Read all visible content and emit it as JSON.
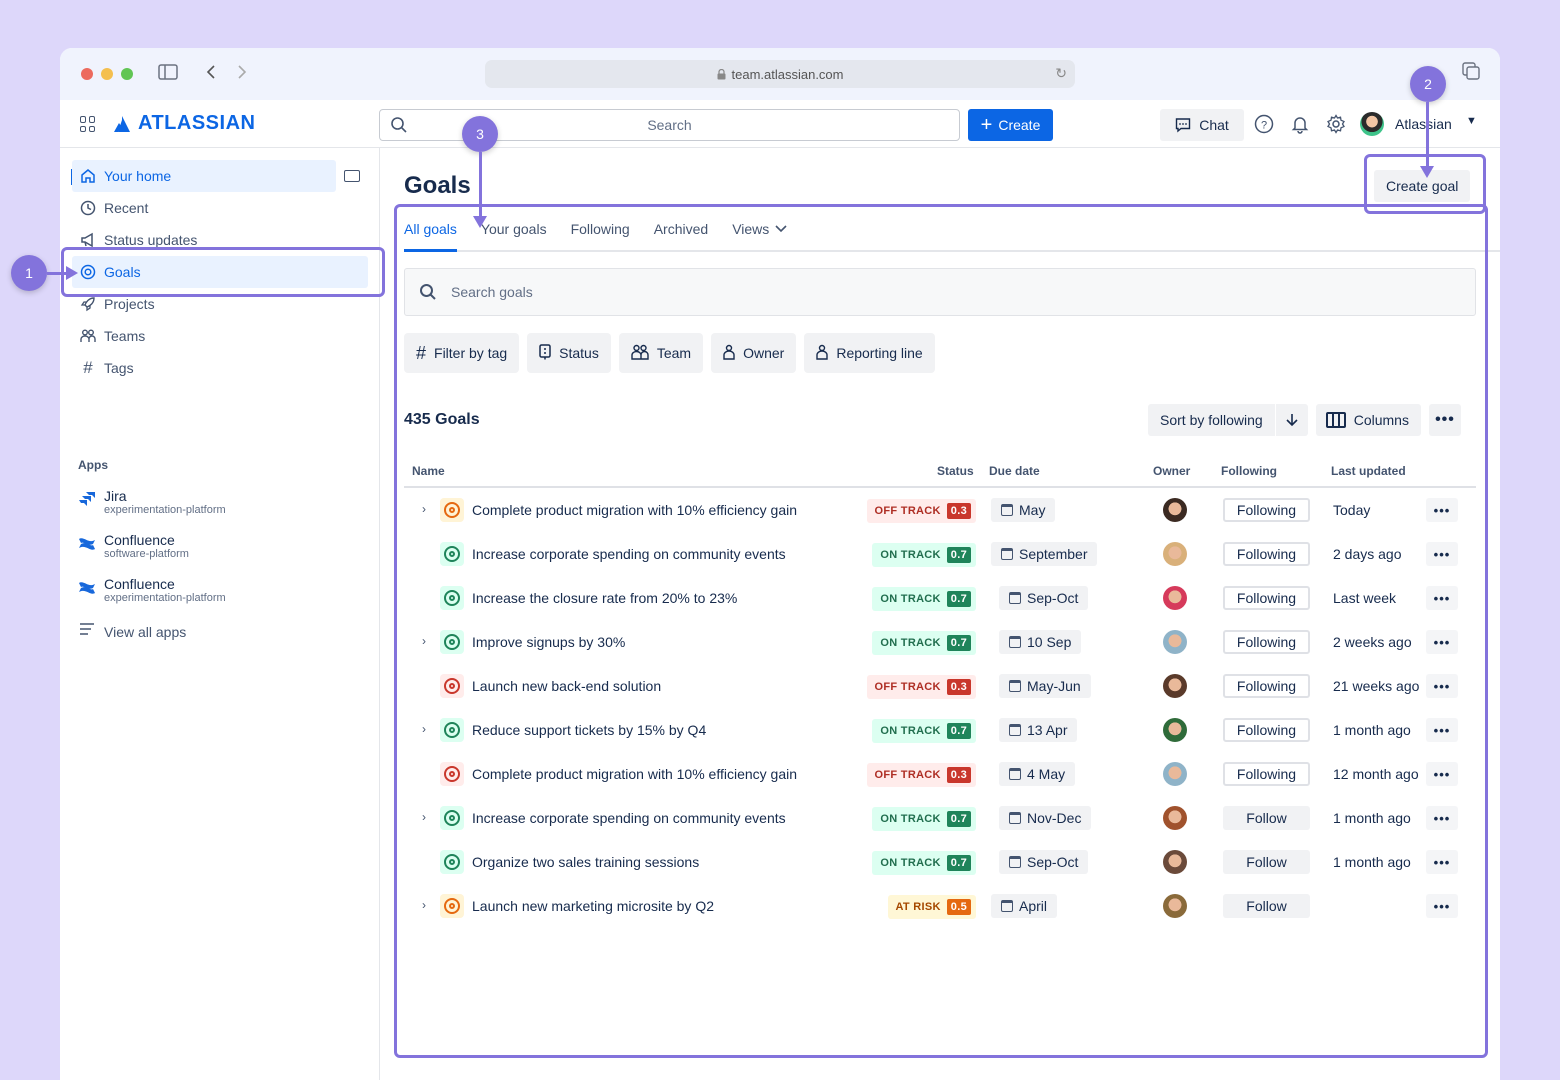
{
  "browser": {
    "url": "team.atlassian.com",
    "icons": [
      "sidebar-toggle-icon",
      "back-icon",
      "forward-icon",
      "lock-icon",
      "reload-icon",
      "tabs-icon"
    ]
  },
  "topnav": {
    "brand": "ATLASSIAN",
    "search_placeholder": "Search",
    "create_label": "Create",
    "chat_label": "Chat",
    "user_name": "Atlassian"
  },
  "sidebar": {
    "items": [
      {
        "label": "Your home",
        "icon": "home-icon"
      },
      {
        "label": "Recent",
        "icon": "clock-icon"
      },
      {
        "label": "Status updates",
        "icon": "megaphone-icon"
      },
      {
        "label": "Goals",
        "icon": "goal-icon"
      },
      {
        "label": "Projects",
        "icon": "rocket-icon"
      },
      {
        "label": "Teams",
        "icon": "people-icon"
      },
      {
        "label": "Tags",
        "icon": "hash-icon"
      }
    ],
    "apps_heading": "Apps",
    "apps": [
      {
        "name": "Jira",
        "sub": "experimentation-platform"
      },
      {
        "name": "Confluence",
        "sub": "software-platform"
      },
      {
        "name": "Confluence",
        "sub": "experimentation-platform"
      }
    ],
    "view_all": "View all apps"
  },
  "main": {
    "title": "Goals",
    "create_goal": "Create goal",
    "tabs": [
      {
        "label": "All goals",
        "active": true
      },
      {
        "label": "Your goals"
      },
      {
        "label": "Following"
      },
      {
        "label": "Archived"
      },
      {
        "label": "Views"
      }
    ],
    "search_placeholder": "Search goals",
    "filters": [
      "Filter by tag",
      "Status",
      "Team",
      "Owner",
      "Reporting line"
    ],
    "count": "435 Goals",
    "sort_label": "Sort by following",
    "columns_label": "Columns",
    "columns": {
      "name": "Name",
      "status": "Status",
      "due": "Due date",
      "owner": "Owner",
      "following": "Following",
      "updated": "Last updated"
    },
    "goals": [
      {
        "name": "Complete product migration with 10% efficiency gain",
        "expandable": true,
        "status": "OFF TRACK",
        "score": "0.3",
        "type": "off",
        "icon_color": "orange",
        "due": "May",
        "following": "Following",
        "updated": "Today"
      },
      {
        "name": "Increase corporate spending on community events",
        "expandable": false,
        "status": "ON TRACK",
        "score": "0.7",
        "type": "on",
        "icon_color": "green",
        "due": "September",
        "following": "Following",
        "updated": "2 days ago"
      },
      {
        "name": "Increase the closure rate from 20% to 23%",
        "expandable": false,
        "status": "ON TRACK",
        "score": "0.7",
        "type": "on",
        "icon_color": "green",
        "due": "Sep-Oct",
        "following": "Following",
        "updated": "Last week"
      },
      {
        "name": "Improve signups by 30%",
        "expandable": true,
        "status": "ON TRACK",
        "score": "0.7",
        "type": "on",
        "icon_color": "green",
        "due": "10 Sep",
        "following": "Following",
        "updated": "2 weeks ago"
      },
      {
        "name": "Launch new back-end solution",
        "expandable": false,
        "status": "OFF TRACK",
        "score": "0.3",
        "type": "off",
        "icon_color": "red",
        "due": "May-Jun",
        "following": "Following",
        "updated": "21 weeks ago"
      },
      {
        "name": "Reduce support tickets by 15% by Q4",
        "expandable": true,
        "status": "ON TRACK",
        "score": "0.7",
        "type": "on",
        "icon_color": "green",
        "due": "13 Apr",
        "following": "Following",
        "updated": "1 month ago"
      },
      {
        "name": "Complete product migration with 10% efficiency gain",
        "expandable": false,
        "status": "OFF TRACK",
        "score": "0.3",
        "type": "off",
        "icon_color": "red",
        "due": "4 May",
        "following": "Following",
        "updated": "12 month ago"
      },
      {
        "name": "Increase corporate spending on community events",
        "expandable": true,
        "status": "ON TRACK",
        "score": "0.7",
        "type": "on",
        "icon_color": "green",
        "due": "Nov-Dec",
        "following": "Follow",
        "updated": "1 month ago"
      },
      {
        "name": "Organize two sales training sessions",
        "expandable": false,
        "status": "ON TRACK",
        "score": "0.7",
        "type": "on",
        "icon_color": "green",
        "due": "Sep-Oct",
        "following": "Follow",
        "updated": "1 month ago"
      },
      {
        "name": "Launch new marketing microsite by Q2",
        "expandable": true,
        "status": "AT RISK",
        "score": "0.5",
        "type": "risk",
        "icon_color": "orange",
        "due": "April",
        "following": "Follow",
        "updated": ""
      }
    ]
  },
  "annotations": [
    "1",
    "2",
    "3"
  ],
  "colors": {
    "accent": "#0c66e4",
    "annotation": "#8373dc",
    "off_track": "#c9372c",
    "on_track": "#1f845a",
    "at_risk": "#e56910"
  }
}
